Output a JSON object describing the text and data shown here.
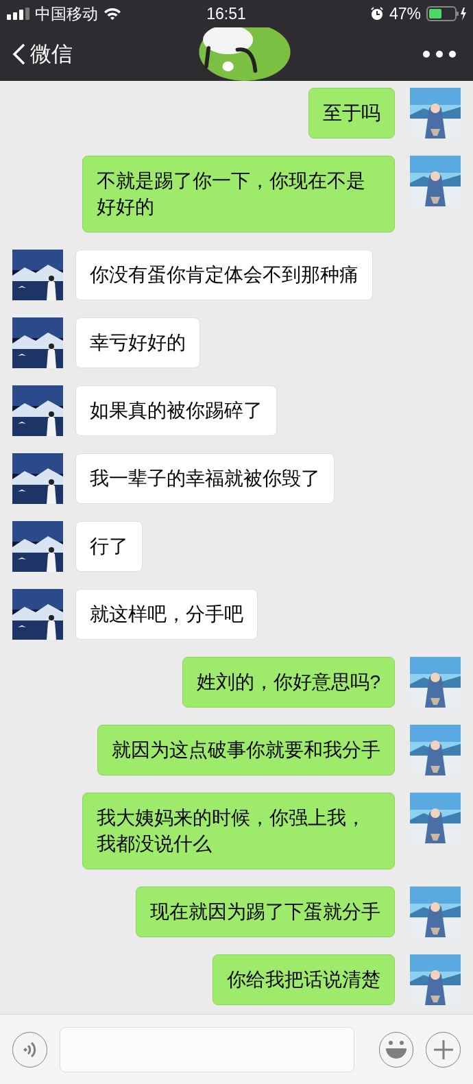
{
  "status_bar": {
    "carrier": "中国移动",
    "time": "16:51",
    "battery": "47%"
  },
  "nav_bar": {
    "back": "微信"
  },
  "messages": [
    {
      "kind": "sent",
      "text": "至于吗"
    },
    {
      "kind": "sent",
      "text": "不就是踢了你一下，你现在不是好好的"
    },
    {
      "kind": "received",
      "text": "你没有蛋你肯定体会不到那种痛"
    },
    {
      "kind": "received",
      "text": "幸亏好好的"
    },
    {
      "kind": "received",
      "text": "如果真的被你踢碎了"
    },
    {
      "kind": "received",
      "text": "我一辈子的幸福就被你毁了"
    },
    {
      "kind": "received",
      "text": "行了"
    },
    {
      "kind": "received",
      "text": "就这样吧，分手吧"
    },
    {
      "kind": "sent",
      "text": "姓刘的，你好意思吗?"
    },
    {
      "kind": "sent",
      "text": "就因为这点破事你就要和我分手"
    },
    {
      "kind": "sent",
      "text": "我大姨妈来的时候，你强上我，我都没说什么"
    },
    {
      "kind": "sent",
      "text": "现在就因为踢了下蛋就分手"
    },
    {
      "kind": "sent",
      "text": "你给我把话说清楚"
    }
  ]
}
